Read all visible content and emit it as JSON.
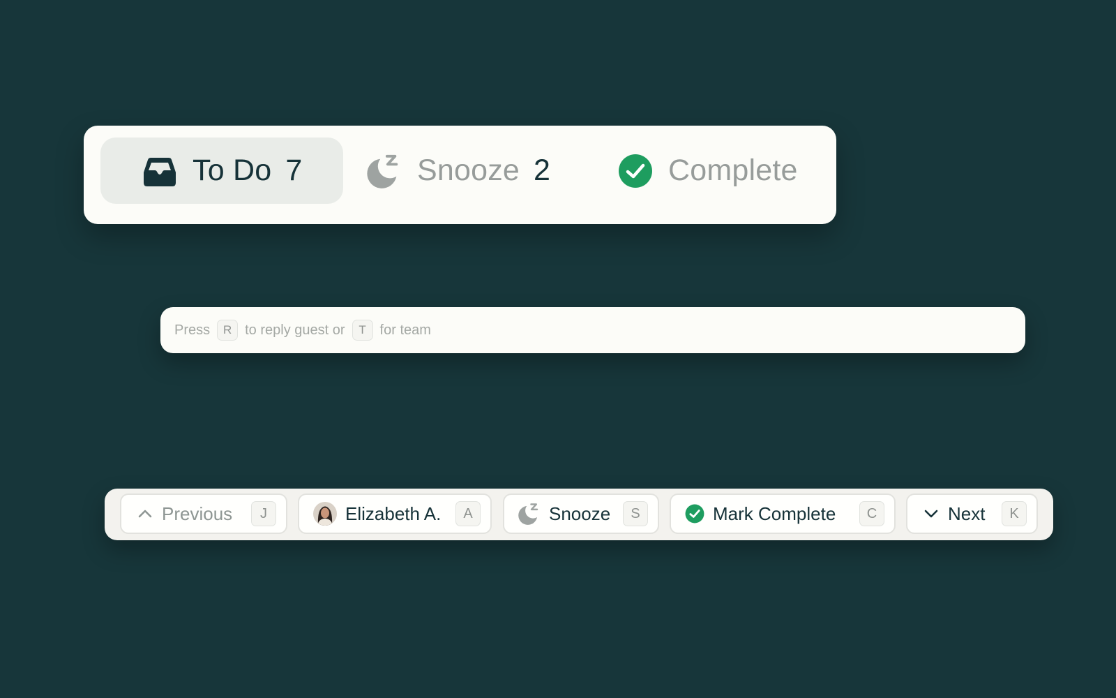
{
  "tabs": {
    "todo": {
      "label": "To Do",
      "count": "7",
      "icon": "inbox-icon"
    },
    "snooze": {
      "label": "Snooze",
      "count": "2",
      "icon": "snooze-moon-icon"
    },
    "complete": {
      "label": "Complete",
      "icon": "check-circle-icon"
    }
  },
  "reply": {
    "press": "Press",
    "reply_key": "R",
    "middle": "to reply guest or",
    "team_key": "T",
    "end": "for team"
  },
  "actions": {
    "previous": {
      "label": "Previous",
      "shortcut": "J",
      "icon": "chevron-up-icon"
    },
    "assignee": {
      "label": "Elizabeth A.",
      "shortcut": "A",
      "icon": "avatar"
    },
    "snooze": {
      "label": "Snooze",
      "shortcut": "S",
      "icon": "snooze-moon-icon"
    },
    "complete": {
      "label": "Mark Complete",
      "shortcut": "C",
      "icon": "check-circle-icon"
    },
    "next": {
      "label": "Next",
      "shortcut": "K",
      "icon": "chevron-down-icon"
    }
  },
  "colors": {
    "background": "#17363A",
    "panel": "#FCFCF8",
    "text_dark": "#163238",
    "text_muted": "#979C9A",
    "success_green": "#1E9D5F",
    "active_tab": "#E9ECE8"
  }
}
